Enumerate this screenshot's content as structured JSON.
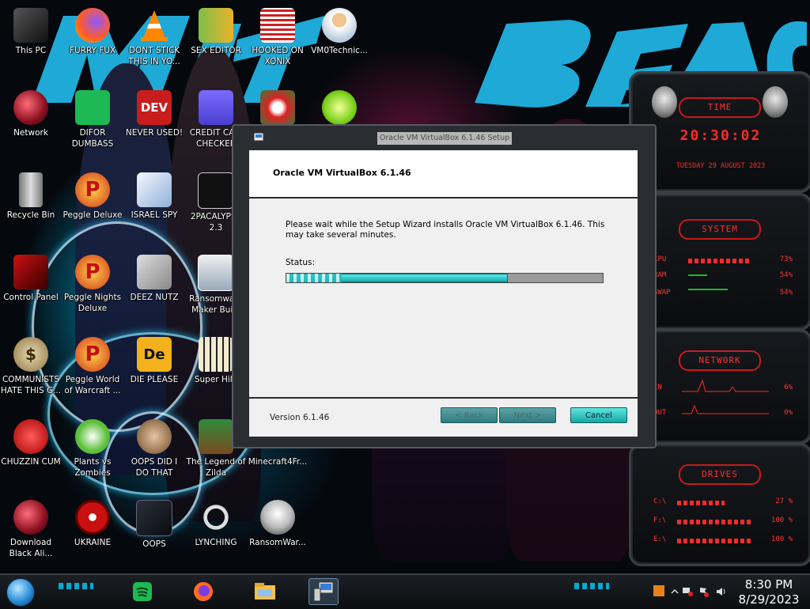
{
  "desktop": {
    "icons": [
      {
        "label": "This PC"
      },
      {
        "label": "FURRY FUX"
      },
      {
        "label": "DONT STICK THIS IN YO..."
      },
      {
        "label": "SEX EDITOR"
      },
      {
        "label": "HOOKED ON XONIX"
      },
      {
        "label": "VM0Technic..."
      },
      {
        "label": "Network"
      },
      {
        "label": "DIFOR DUMBASS"
      },
      {
        "label": "NEVER USED!"
      },
      {
        "label": "CREDIT CA... CHECKER"
      },
      {
        "label": "Recycle Bin"
      },
      {
        "label": "Peggle Deluxe"
      },
      {
        "label": "ISRAEL SPY"
      },
      {
        "label": "2PACALYPSE 2.3"
      },
      {
        "label": "Control Panel"
      },
      {
        "label": "Peggle Nights Deluxe"
      },
      {
        "label": "DEEZ NUTZ"
      },
      {
        "label": "Ransomware Maker Build"
      },
      {
        "label": "COMMUNISTS HATE THIS G..."
      },
      {
        "label": "Peggle World of Warcraft ..."
      },
      {
        "label": "DIE PLEASE"
      },
      {
        "label": "Super Hilo"
      },
      {
        "label": "CHUZZIN CUM"
      },
      {
        "label": "Plants vs Zombies"
      },
      {
        "label": "OOPS DID I DO THAT"
      },
      {
        "label": "The Legend of Zilda"
      },
      {
        "label": "Minecraft4Fr..."
      },
      {
        "label": "Download Black Ali..."
      },
      {
        "label": "UKRAINE"
      },
      {
        "label": "OOPS"
      },
      {
        "label": "LYNCHING"
      },
      {
        "label": "RansomWar..."
      }
    ],
    "icon_badges": {
      "dev": "DEV",
      "peggle": "P",
      "die": "De",
      "money": "$"
    }
  },
  "widgets": {
    "time": {
      "title": "TIME",
      "clock": "20:30:02",
      "date": "TUESDAY 29 AUGUST 2023"
    },
    "system": {
      "title": "SYSTEM",
      "rows": [
        {
          "label": "CPU",
          "value": "73%"
        },
        {
          "label": "RAM",
          "value": "54%"
        },
        {
          "label": "SWAP",
          "value": "54%"
        }
      ]
    },
    "network": {
      "title": "NETWORK",
      "rows": [
        {
          "label": "IN",
          "value": "6%"
        },
        {
          "label": "OUT",
          "value": "0%"
        }
      ]
    },
    "drives": {
      "title": "DRIVES",
      "rows": [
        {
          "label": "C:\\",
          "value": "27 %"
        },
        {
          "label": "F:\\",
          "value": "100 %"
        },
        {
          "label": "E:\\",
          "value": "100 %"
        }
      ]
    }
  },
  "dialog": {
    "window_title": "Oracle VM VirtualBox 6.1.46 Setup",
    "heading": "Oracle VM VirtualBox 6.1.46",
    "message": "Please wait while the Setup Wizard installs Oracle VM VirtualBox 6.1.46. This may take several minutes.",
    "status_label": "Status:",
    "progress": 0.7,
    "version": "Version 6.1.46",
    "buttons": {
      "back": "< Back",
      "next": "Next >",
      "cancel": "Cancel"
    }
  },
  "taskbar": {
    "time": "8:30 PM",
    "date": "8/29/2023"
  },
  "colors": {
    "accent_cyan": "#2ec8ff",
    "widget_red": "#ff3030",
    "progress_fill": "#12a8a8"
  }
}
